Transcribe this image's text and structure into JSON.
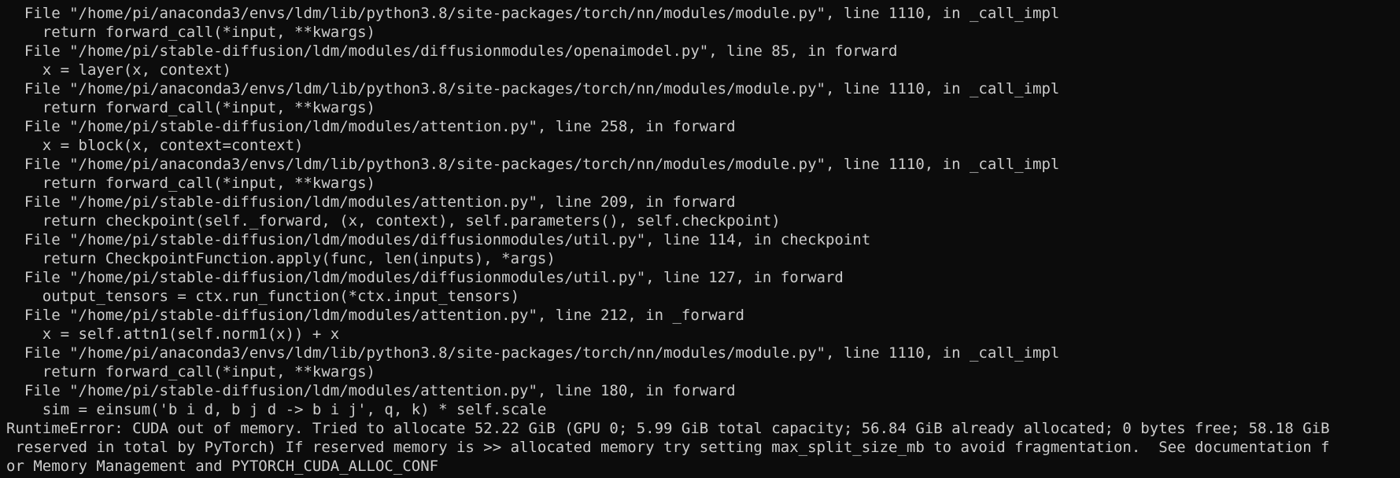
{
  "terminal": {
    "lines": [
      "  File \"/home/pi/anaconda3/envs/ldm/lib/python3.8/site-packages/torch/nn/modules/module.py\", line 1110, in _call_impl",
      "    return forward_call(*input, **kwargs)",
      "  File \"/home/pi/stable-diffusion/ldm/modules/diffusionmodules/openaimodel.py\", line 85, in forward",
      "    x = layer(x, context)",
      "  File \"/home/pi/anaconda3/envs/ldm/lib/python3.8/site-packages/torch/nn/modules/module.py\", line 1110, in _call_impl",
      "    return forward_call(*input, **kwargs)",
      "  File \"/home/pi/stable-diffusion/ldm/modules/attention.py\", line 258, in forward",
      "    x = block(x, context=context)",
      "  File \"/home/pi/anaconda3/envs/ldm/lib/python3.8/site-packages/torch/nn/modules/module.py\", line 1110, in _call_impl",
      "    return forward_call(*input, **kwargs)",
      "  File \"/home/pi/stable-diffusion/ldm/modules/attention.py\", line 209, in forward",
      "    return checkpoint(self._forward, (x, context), self.parameters(), self.checkpoint)",
      "  File \"/home/pi/stable-diffusion/ldm/modules/diffusionmodules/util.py\", line 114, in checkpoint",
      "    return CheckpointFunction.apply(func, len(inputs), *args)",
      "  File \"/home/pi/stable-diffusion/ldm/modules/diffusionmodules/util.py\", line 127, in forward",
      "    output_tensors = ctx.run_function(*ctx.input_tensors)",
      "  File \"/home/pi/stable-diffusion/ldm/modules/attention.py\", line 212, in _forward",
      "    x = self.attn1(self.norm1(x)) + x",
      "  File \"/home/pi/anaconda3/envs/ldm/lib/python3.8/site-packages/torch/nn/modules/module.py\", line 1110, in _call_impl",
      "    return forward_call(*input, **kwargs)",
      "  File \"/home/pi/stable-diffusion/ldm/modules/attention.py\", line 180, in forward",
      "    sim = einsum('b i d, b j d -> b i j', q, k) * self.scale",
      "RuntimeError: CUDA out of memory. Tried to allocate 52.22 GiB (GPU 0; 5.99 GiB total capacity; 56.84 GiB already allocated; 0 bytes free; 58.18 GiB",
      " reserved in total by PyTorch) If reserved memory is >> allocated memory try setting max_split_size_mb to avoid fragmentation.  See documentation f",
      "or Memory Management and PYTORCH_CUDA_ALLOC_CONF"
    ]
  },
  "colors": {
    "background": "#0c0c0c",
    "text": "#cccccc"
  }
}
